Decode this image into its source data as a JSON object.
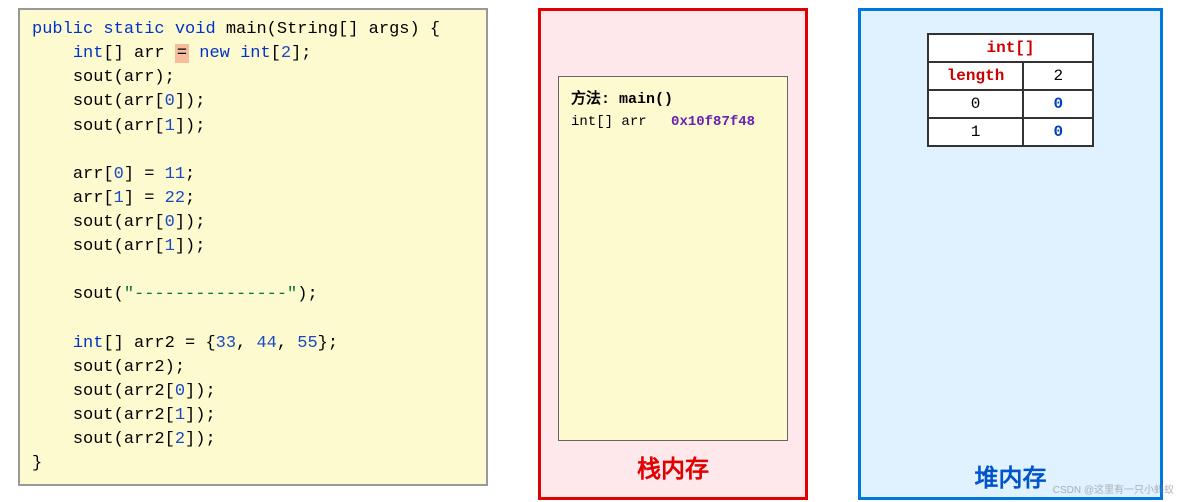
{
  "code": {
    "lines": [
      {
        "indent": 0,
        "tokens": [
          {
            "t": "public",
            "c": "kw"
          },
          {
            "t": " "
          },
          {
            "t": "static",
            "c": "kw"
          },
          {
            "t": " "
          },
          {
            "t": "void",
            "c": "kw"
          },
          {
            "t": " main(String[] args) {"
          }
        ]
      },
      {
        "indent": 1,
        "tokens": [
          {
            "t": "int",
            "c": "kw"
          },
          {
            "t": "[] arr "
          },
          {
            "t": "=",
            "c": "highlight"
          },
          {
            "t": " "
          },
          {
            "t": "new",
            "c": "kw"
          },
          {
            "t": " "
          },
          {
            "t": "int",
            "c": "kw"
          },
          {
            "t": "["
          },
          {
            "t": "2",
            "c": "num"
          },
          {
            "t": "];"
          }
        ]
      },
      {
        "indent": 1,
        "tokens": [
          {
            "t": "sout(arr);"
          }
        ]
      },
      {
        "indent": 1,
        "tokens": [
          {
            "t": "sout(arr["
          },
          {
            "t": "0",
            "c": "num"
          },
          {
            "t": "]);"
          }
        ]
      },
      {
        "indent": 1,
        "tokens": [
          {
            "t": "sout(arr["
          },
          {
            "t": "1",
            "c": "num"
          },
          {
            "t": "]);"
          }
        ]
      },
      {
        "indent": 1,
        "tokens": []
      },
      {
        "indent": 1,
        "tokens": [
          {
            "t": "arr["
          },
          {
            "t": "0",
            "c": "num"
          },
          {
            "t": "] = "
          },
          {
            "t": "11",
            "c": "num"
          },
          {
            "t": ";"
          }
        ]
      },
      {
        "indent": 1,
        "tokens": [
          {
            "t": "arr["
          },
          {
            "t": "1",
            "c": "num"
          },
          {
            "t": "] = "
          },
          {
            "t": "22",
            "c": "num"
          },
          {
            "t": ";"
          }
        ]
      },
      {
        "indent": 1,
        "tokens": [
          {
            "t": "sout(arr["
          },
          {
            "t": "0",
            "c": "num"
          },
          {
            "t": "]);"
          }
        ]
      },
      {
        "indent": 1,
        "tokens": [
          {
            "t": "sout(arr["
          },
          {
            "t": "1",
            "c": "num"
          },
          {
            "t": "]);"
          }
        ]
      },
      {
        "indent": 1,
        "tokens": []
      },
      {
        "indent": 1,
        "tokens": [
          {
            "t": "sout("
          },
          {
            "t": "\"---------------\"",
            "c": "str"
          },
          {
            "t": ");"
          }
        ]
      },
      {
        "indent": 1,
        "tokens": []
      },
      {
        "indent": 1,
        "tokens": [
          {
            "t": "int",
            "c": "kw"
          },
          {
            "t": "[] arr2 = {"
          },
          {
            "t": "33",
            "c": "num"
          },
          {
            "t": ", "
          },
          {
            "t": "44",
            "c": "num"
          },
          {
            "t": ", "
          },
          {
            "t": "55",
            "c": "num"
          },
          {
            "t": "};"
          }
        ]
      },
      {
        "indent": 1,
        "tokens": [
          {
            "t": "sout(arr2);"
          }
        ]
      },
      {
        "indent": 1,
        "tokens": [
          {
            "t": "sout(arr2["
          },
          {
            "t": "0",
            "c": "num"
          },
          {
            "t": "]);"
          }
        ]
      },
      {
        "indent": 1,
        "tokens": [
          {
            "t": "sout(arr2["
          },
          {
            "t": "1",
            "c": "num"
          },
          {
            "t": "]);"
          }
        ]
      },
      {
        "indent": 1,
        "tokens": [
          {
            "t": "sout(arr2["
          },
          {
            "t": "2",
            "c": "num"
          },
          {
            "t": "]);"
          }
        ]
      },
      {
        "indent": 0,
        "tokens": [
          {
            "t": "}"
          }
        ]
      }
    ]
  },
  "stack": {
    "title": "栈内存",
    "method_label": "方法:",
    "method_name": "main()",
    "var_type": "int[]",
    "var_name": "arr",
    "var_addr": "0x10f87f48"
  },
  "heap": {
    "title": "堆内存",
    "header": "int[]",
    "length_label": "length",
    "length_value": "2",
    "rows": [
      {
        "idx": "0",
        "val": "0"
      },
      {
        "idx": "1",
        "val": "0"
      }
    ]
  },
  "watermark": "CSDN @这里有一只小蚂蚁"
}
